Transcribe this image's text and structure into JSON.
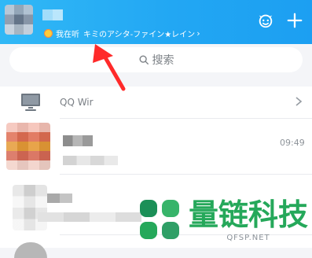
{
  "header": {
    "status_prefix": "我在听",
    "status_song": "キミのアシタ-ファイン★レイン",
    "status_chevron": "›",
    "icons": [
      "mascot-icon",
      "plus-icon"
    ]
  },
  "search": {
    "placeholder": "搜索"
  },
  "list": {
    "top_row": {
      "label": "QQ Wir",
      "icon": "computer-icon",
      "trailing_icon": "chevron-right-icon"
    },
    "chat_row": {
      "time": "09:49"
    }
  },
  "watermark": {
    "title": "量链科技",
    "subtitle": "QFSP.NET"
  },
  "colors": {
    "header_gradient_start": "#31b8f6",
    "header_gradient_end": "#1c9ff2",
    "annotation_arrow": "#ff2a2a",
    "watermark_green": "#25a85a"
  }
}
